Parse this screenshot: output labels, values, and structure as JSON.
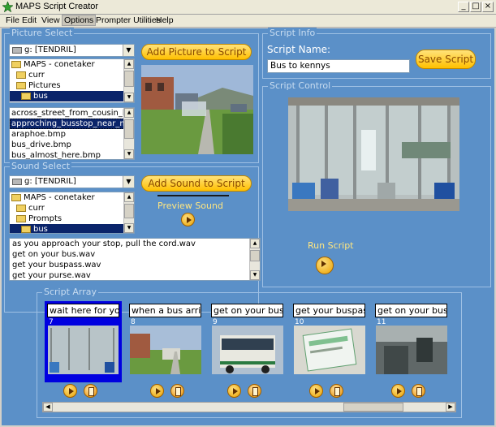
{
  "window": {
    "title": "MAPS Script Creator",
    "minimize": "_",
    "maximize": "□",
    "close": "×"
  },
  "menu": [
    "File",
    "Edit",
    "View",
    "Options",
    "Prompter Utilities",
    "Help"
  ],
  "picture_select": {
    "label": "Picture Select",
    "drive": "g: [TENDRIL]",
    "folders": [
      "MAPS - conetaker",
      "curr",
      "Pictures",
      "bus"
    ],
    "files": [
      "across_street_from_cousin_house.bmp",
      "approching_busstop_near_my_house.bmp",
      "araphoe.bmp",
      "bus_drive.bmp",
      "bus_almost_here.bmp"
    ],
    "add_button": "Add Picture to Script"
  },
  "sound_select": {
    "label": "Sound Select",
    "drive": "g: [TENDRIL]",
    "folders": [
      "MAPS - conetaker",
      "curr",
      "Prompts",
      "bus"
    ],
    "files": [
      "as you approach your stop, pull the cord.wav",
      "get on your bus.wav",
      "get your buspass.wav",
      "get your purse.wav"
    ],
    "add_button": "Add Sound to Script",
    "preview_label": "Preview Sound"
  },
  "script_info": {
    "label": "Script Info",
    "name_label": "Script Name:",
    "name_value": "Bus to kennys",
    "save_button": "Save Script"
  },
  "script_control": {
    "label": "Script Control",
    "run_label": "Run Script"
  },
  "script_array": {
    "label": "Script Array",
    "cards": [
      {
        "text": "wait here for you",
        "num": "7",
        "selected": true
      },
      {
        "text": "when a bus arrive",
        "num": "8",
        "selected": false
      },
      {
        "text": "get on your bus.w",
        "num": "9",
        "selected": false
      },
      {
        "text": "get your buspass",
        "num": "10",
        "selected": false
      },
      {
        "text": "get on your bus.w",
        "num": "11",
        "selected": false
      }
    ]
  },
  "colors": {
    "panel": "#5b90c8",
    "accent_yellow": "#ffc000",
    "selection": "#0a246a",
    "card_selected": "#0000e0"
  }
}
